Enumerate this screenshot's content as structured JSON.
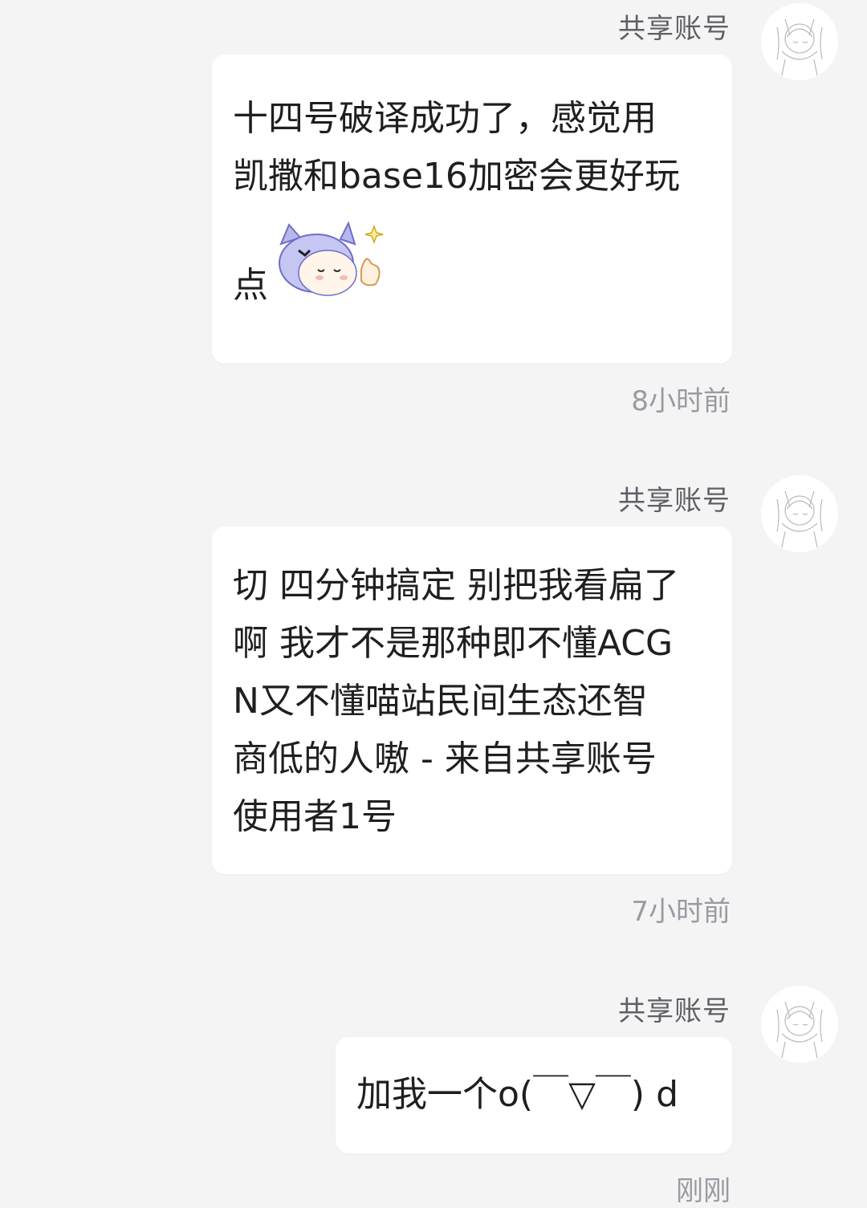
{
  "messages": [
    {
      "sender": "共享账号",
      "lines": [
        "十四号破译成功了，感觉用",
        "凯撒和base16加密会更好玩"
      ],
      "tail": "点",
      "sticker": "cat-girl-thumbs-up-sticker",
      "time": "8小时前"
    },
    {
      "sender": "共享账号",
      "lines": [
        "切 四分钟搞定 别把我看扁了",
        "啊 我才不是那种即不懂ACG",
        "N又不懂喵站民间生态还智",
        "商低的人嗷 - 来自共享账号",
        "使用者1号"
      ],
      "time": "7小时前"
    },
    {
      "sender": "共享账号",
      "lines": [
        "加我一个o(￣▽￣) d"
      ],
      "time": "刚刚"
    }
  ],
  "colors": {
    "background": "#f4f4f5",
    "bubble": "#ffffff",
    "text": "#1f1f22",
    "meta": "#9a9aa2"
  }
}
